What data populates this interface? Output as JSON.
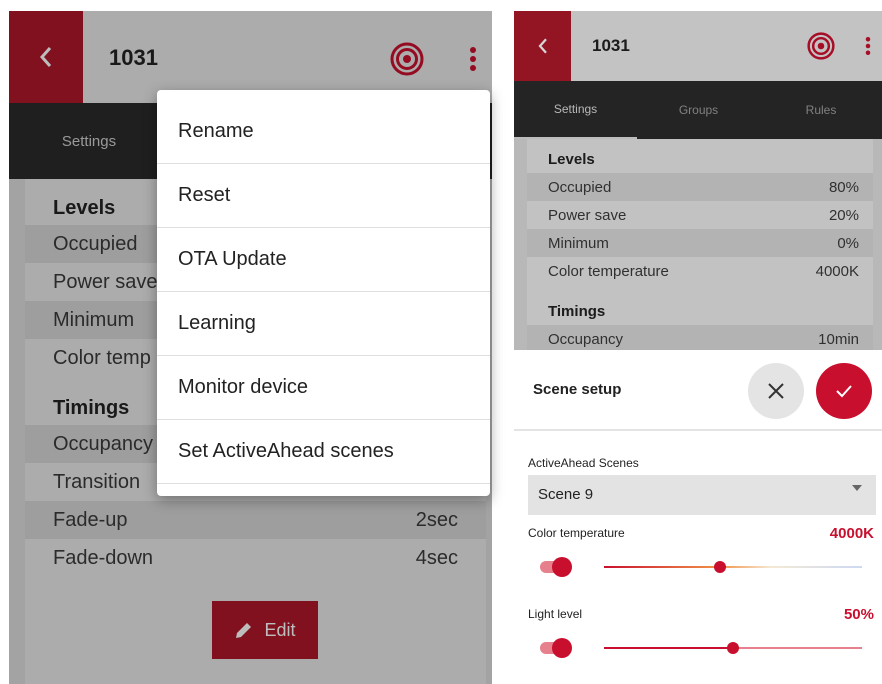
{
  "left": {
    "header": {
      "title": "1031"
    },
    "tabs": [
      {
        "label": "Settings"
      }
    ],
    "levels": {
      "title": "Levels",
      "rows": [
        {
          "label": "Occupied"
        },
        {
          "label": "Power save"
        },
        {
          "label": "Minimum"
        },
        {
          "label": "Color temp"
        }
      ]
    },
    "timings": {
      "title": "Timings",
      "rows": [
        {
          "label": "Occupancy",
          "value": ""
        },
        {
          "label": "Transition",
          "value": ""
        },
        {
          "label": "Fade-up",
          "value": "2sec"
        },
        {
          "label": "Fade-down",
          "value": "4sec"
        }
      ]
    },
    "edit_label": "Edit",
    "menu": [
      "Rename",
      "Reset",
      "OTA Update",
      "Learning",
      "Monitor device",
      "Set ActiveAhead scenes"
    ]
  },
  "right": {
    "header": {
      "title": "1031"
    },
    "tabs": [
      {
        "label": "Settings"
      },
      {
        "label": "Groups"
      },
      {
        "label": "Rules"
      }
    ],
    "levels": {
      "title": "Levels",
      "rows": [
        {
          "label": "Occupied",
          "value": "80%"
        },
        {
          "label": "Power save",
          "value": "20%"
        },
        {
          "label": "Minimum",
          "value": "0%"
        },
        {
          "label": "Color temperature",
          "value": "4000K"
        }
      ]
    },
    "timings": {
      "title": "Timings",
      "rows": [
        {
          "label": "Occupancy",
          "value": "10min"
        }
      ]
    },
    "scene_setup": {
      "title": "Scene setup",
      "dropdown_label": "ActiveAhead Scenes",
      "dropdown_value": "Scene 9",
      "color_temp_label": "Color temperature",
      "color_temp_value": "4000K",
      "color_temp_fraction": 0.45,
      "light_level_label": "Light level",
      "light_level_value": "50%",
      "light_level_fraction": 0.5
    }
  },
  "colors": {
    "accent": "#c8102e",
    "header_red": "#b0182a",
    "tabbar": "#2b2b2b"
  },
  "icons": [
    "chevron-left-icon",
    "target-icon",
    "more-vert-icon",
    "pencil-icon",
    "close-icon",
    "check-icon",
    "dropdown-caret-icon"
  ]
}
